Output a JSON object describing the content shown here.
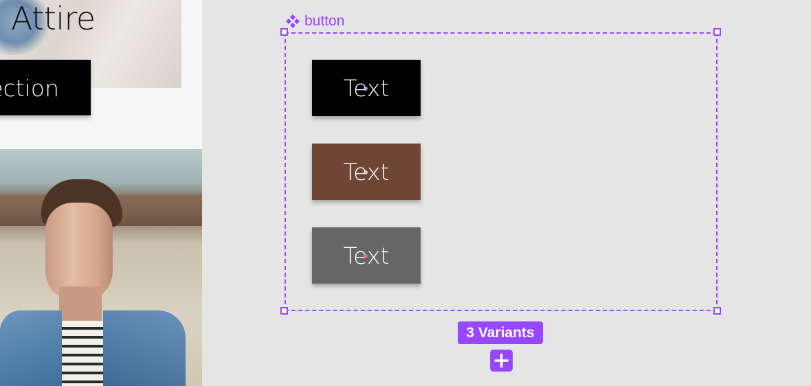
{
  "preview": {
    "hero_title": "Attire",
    "cta_label": "ection"
  },
  "component_set": {
    "name": "button",
    "icon": "component-diamond-icon",
    "accent_color": "#9747ff",
    "variants": [
      {
        "label": "Text",
        "background": "#000000"
      },
      {
        "label": "Text",
        "background": "#6f4634"
      },
      {
        "label": "Text",
        "background": "#666666"
      }
    ],
    "variants_badge": "3 Variants",
    "add_variant_icon": "plus-icon"
  }
}
